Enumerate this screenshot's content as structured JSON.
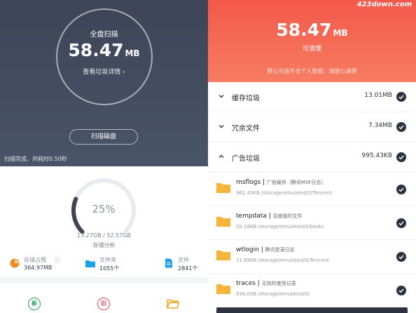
{
  "left": {
    "scan": {
      "title": "全盘扫描",
      "size_value": "58.47",
      "size_unit": "MB",
      "details_link": "查看垃圾详情 ›",
      "scan_button": "扫描磁盘",
      "status": "扫描完成，共耗时0.50秒"
    },
    "storage": {
      "percent": "25%",
      "percent_fraction": 0.25,
      "size": "13.27GB / 52.57GB",
      "label": "存储分析"
    },
    "stats": [
      {
        "icon": "storage-pie-icon",
        "label": "存储占用",
        "value": "364.97MB",
        "color": "#f08a24"
      },
      {
        "icon": "folder-icon",
        "label": "文件夹",
        "value": "1055个",
        "color": "#1ea1e8"
      },
      {
        "icon": "document-icon",
        "label": "文件",
        "value": "2841个",
        "color": "#1ea1e8"
      }
    ],
    "bottom_nav": [
      {
        "icon": "new-icon",
        "glyph": "新",
        "color": "#22a35a"
      },
      {
        "icon": "old-icon",
        "glyph": "旧",
        "color": "#e54b59"
      },
      {
        "icon": "folder-open-icon",
        "glyph": "",
        "color": "#f0a020"
      }
    ]
  },
  "right": {
    "watermark": "423down.com",
    "size_value": "58.47",
    "size_unit": "MB",
    "subtitle": "可清理",
    "note": "默认勾选不含个人数据，请放心清理",
    "categories": [
      {
        "name": "缓存垃圾",
        "size": "13.01MB",
        "expanded": false
      },
      {
        "name": "冗余文件",
        "size": "7.34MB",
        "expanded": false
      },
      {
        "name": "广告垃圾",
        "size": "995.43KB",
        "expanded": true
      }
    ],
    "items": [
      {
        "name": "msflogs",
        "desc": "广告缓存（腾讯MSF日志）",
        "size": "962.43KB",
        "path": "/storage/emulated/0/Tencent"
      },
      {
        "name": "tempdata",
        "desc": "百度临时文件",
        "size": "20.18KB",
        "path": "/storage/emulated/0/baidu"
      },
      {
        "name": "wtlogin",
        "desc": "腾讯登录日志",
        "size": "11.69KB",
        "path": "/storage/emulated/0/Tencent"
      },
      {
        "name": "traces",
        "desc": "无效的使用记录",
        "size": "938.00B",
        "path": "/storage/emulated/0/"
      }
    ],
    "colors": {
      "accent": "#f3584a",
      "dark": "#2c3340",
      "folder": "#f5b53a"
    }
  }
}
